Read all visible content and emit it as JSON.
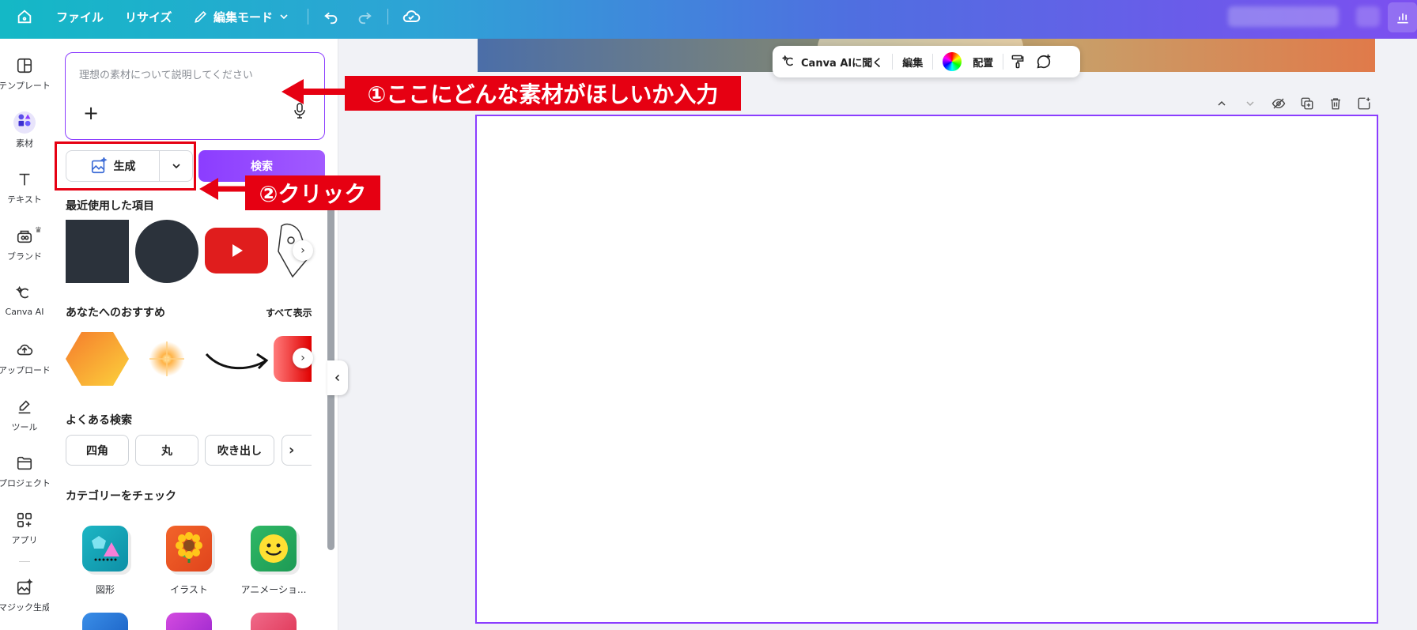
{
  "topbar": {
    "file_label": "ファイル",
    "resize_label": "リサイズ",
    "mode_label": "編集モード"
  },
  "rail": {
    "items": [
      {
        "label": "テンプレート",
        "icon": "template-icon"
      },
      {
        "label": "素材",
        "icon": "elements-icon"
      },
      {
        "label": "テキスト",
        "icon": "text-icon"
      },
      {
        "label": "ブランド",
        "icon": "brand-icon"
      },
      {
        "label": "Canva AI",
        "icon": "canva-ai-icon"
      },
      {
        "label": "アップロード",
        "icon": "upload-icon"
      },
      {
        "label": "ツール",
        "icon": "draw-tool-icon"
      },
      {
        "label": "プロジェクト",
        "icon": "folder-icon"
      },
      {
        "label": "アプリ",
        "icon": "apps-icon"
      },
      {
        "label": "マジック生成",
        "icon": "magic-generate-icon"
      }
    ]
  },
  "panel": {
    "prompt_placeholder": "理想の素材について説明してください",
    "generate_label": "生成",
    "search_label": "検索",
    "recent_title": "最近使用した項目",
    "recommend_title": "あなたへのおすすめ",
    "see_all_label": "すべて表示",
    "popular_title": "よくある検索",
    "chips": [
      "四角",
      "丸",
      "吹き出し"
    ],
    "category_title": "カテゴリーをチェック",
    "categories": [
      {
        "label": "図形"
      },
      {
        "label": "イラスト"
      },
      {
        "label": "アニメーショ..."
      }
    ]
  },
  "canvas_toolbar": {
    "ask_ai_label": "Canva AIに聞く",
    "edit_label": "編集",
    "arrange_label": "配置"
  },
  "annotations": {
    "step1": "①ここにどんな素材がほしいか入力",
    "step2": "②クリック"
  },
  "colors": {
    "accent": "#8b3dff",
    "annotation_red": "#e60012"
  }
}
